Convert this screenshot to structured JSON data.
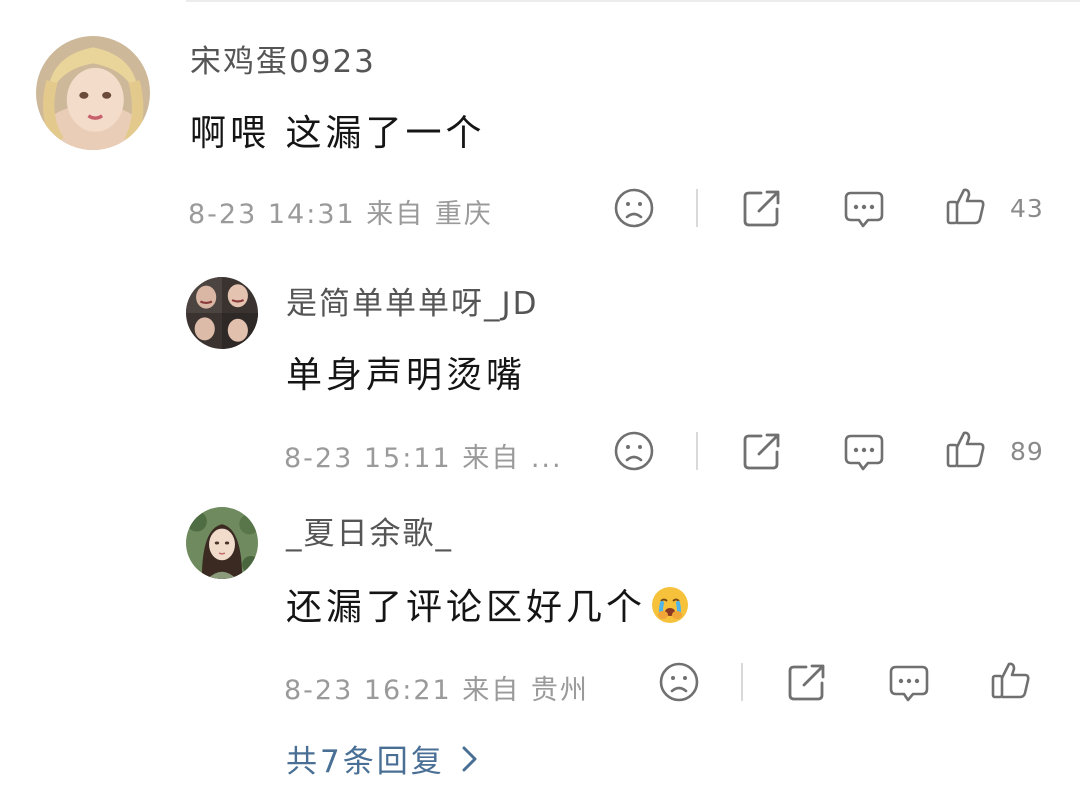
{
  "comments": [
    {
      "username": "宋鸡蛋0923",
      "content": "啊喂 这漏了一个",
      "meta": "8-23 14:31 来自 重庆",
      "likes": "43"
    },
    {
      "username": "是简单单单呀_JD",
      "content": "单身声明烫嘴",
      "meta": "8-23 15:11 来自 ...",
      "likes": "89"
    },
    {
      "username": "_夏日余歌_",
      "content": "还漏了评论区好几个",
      "meta": "8-23 16:21 来自 贵州",
      "likes": ""
    }
  ],
  "replies_link": "共7条回复",
  "icons": {
    "dislike": "sad-face-icon",
    "share": "share-icon",
    "comment": "comment-icon",
    "like": "thumbs-up-icon",
    "emoji": "crying-emoji-icon"
  },
  "colors": {
    "link": "#4a6f95",
    "meta": "#9a9a9a",
    "icon": "#707070"
  }
}
